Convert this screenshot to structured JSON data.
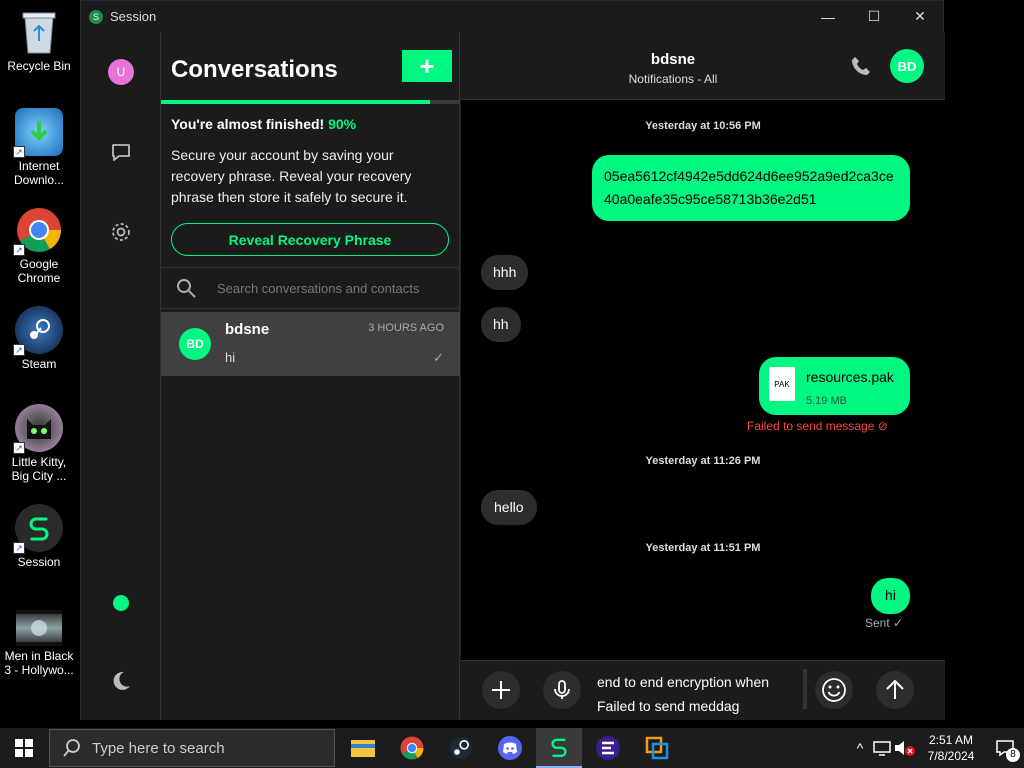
{
  "desktop": {
    "icons": [
      {
        "label": "Recycle Bin"
      },
      {
        "label": "Internet Downlo..."
      },
      {
        "label": "Google Chrome"
      },
      {
        "label": "Steam"
      },
      {
        "label": "Little Kitty, Big City ..."
      },
      {
        "label": "Session"
      },
      {
        "label": "Men in Black 3 - Hollywo..."
      }
    ]
  },
  "window": {
    "title": "Session",
    "controls": {
      "minimize": "—",
      "maximize": "☐",
      "close": "✕"
    }
  },
  "rail": {
    "avatar_initial": "U",
    "icons": [
      "message-icon",
      "gear-icon",
      "moon-icon"
    ],
    "online_color": "#00f782"
  },
  "conversations": {
    "title": "Conversations",
    "new_button": "+",
    "progress_percent": 90,
    "almost_label": "You're almost finished!",
    "almost_pct": "90%",
    "secure_text": "Secure your account by saving your recovery phrase. Reveal your recovery phrase then store it safely to secure it.",
    "reveal_button": "Reveal Recovery Phrase",
    "search_placeholder": "Search conversations and contacts",
    "items": [
      {
        "avatar": "BD",
        "name": "bdsne",
        "time": "3 HOURS AGO",
        "snippet": "hi",
        "status": "✓"
      }
    ]
  },
  "chat": {
    "name": "bdsne",
    "subtitle": "Notifications - All",
    "avatar": "BD",
    "timestamps": [
      "Yesterday at 10:56 PM",
      "Yesterday at 11:26 PM",
      "Yesterday at 11:51 PM"
    ],
    "messages": {
      "hash": "05ea5612cf4942e5dd624d6ee952a9ed2ca3ce40a0eafe35c95ce58713b36e2d51",
      "hhh": "hhh",
      "hh": "hh",
      "file_name": "resources.pak",
      "file_size": "5.19 MB",
      "file_ext": "PAK",
      "file_status": "Failed to send message ⊘",
      "hello": "hello",
      "hi": "hi",
      "hi_status": "Sent ✓"
    },
    "composer": {
      "line1": "end to end encryption when",
      "line2": "Failed to send meddag"
    }
  },
  "taskbar": {
    "search_placeholder": "Type here to search",
    "time": "2:51 AM",
    "date": "7/8/2024",
    "notification_count": "8"
  },
  "colors": {
    "accent": "#00f782",
    "error": "#ff453a"
  }
}
